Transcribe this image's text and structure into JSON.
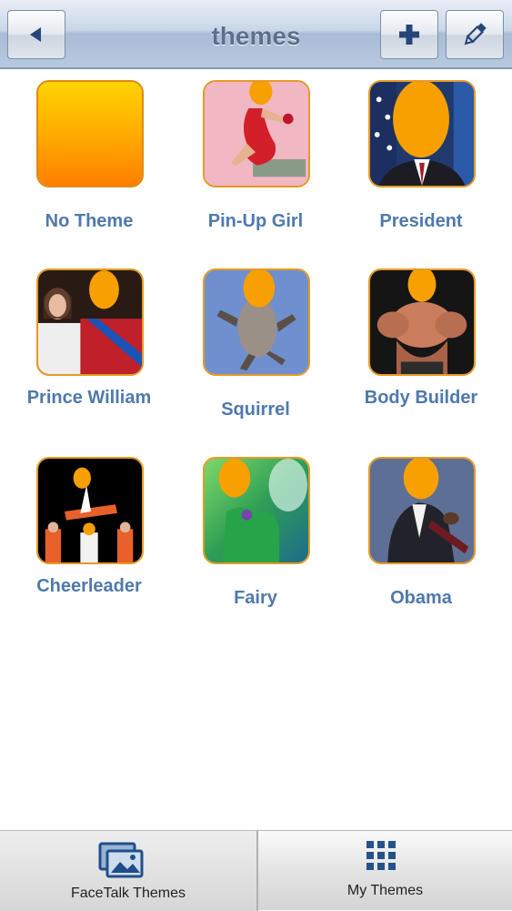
{
  "header": {
    "title": "themes",
    "back_icon": "back-arrow-icon",
    "add_icon": "plus-icon",
    "edit_icon": "pencil-icon"
  },
  "themes": [
    {
      "label": "No Theme",
      "image": "orange-square"
    },
    {
      "label": "Pin-Up Girl",
      "image": "pin-up-girl-photo"
    },
    {
      "label": "President",
      "image": "president-photo"
    },
    {
      "label": "Prince William",
      "image": "prince-william-photo"
    },
    {
      "label": "Squirrel",
      "image": "squirrel-photo"
    },
    {
      "label": "Body Builder",
      "image": "body-builder-photo"
    },
    {
      "label": "Cheerleader",
      "image": "cheerleader-photo"
    },
    {
      "label": "Fairy",
      "image": "fairy-photo"
    },
    {
      "label": "Obama",
      "image": "obama-photo"
    }
  ],
  "tabbar": {
    "left_label": "FaceTalk Themes",
    "left_icon": "photo-stack-icon",
    "right_label": "My Themes",
    "right_icon": "grid-icon"
  },
  "colors": {
    "accent_orange": "#f7a21b",
    "label_blue": "#4f79ad",
    "title_gray_blue": "#5b6f8e"
  }
}
